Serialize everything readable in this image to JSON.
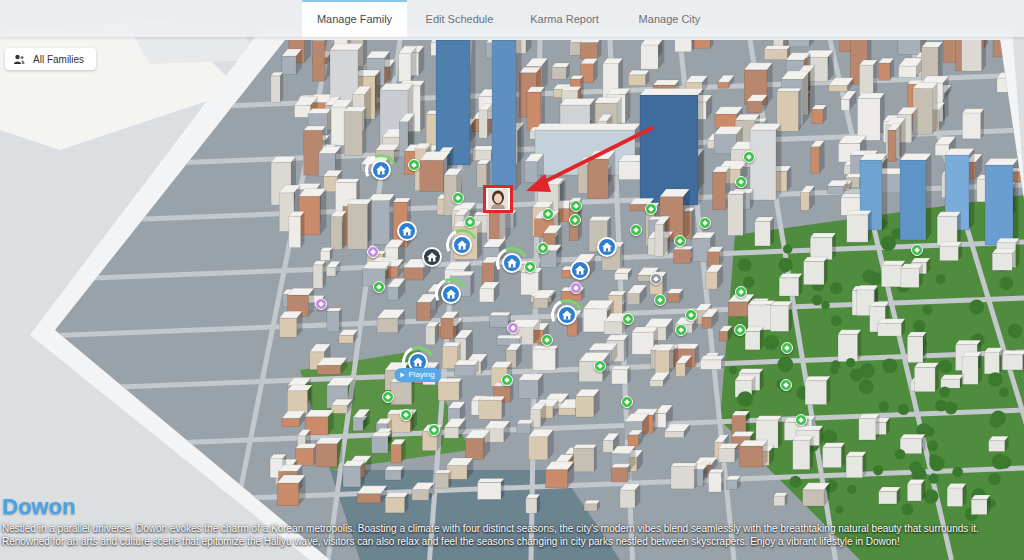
{
  "tabs": [
    {
      "label": "Manage Family",
      "selected": true
    },
    {
      "label": "Edit Schedule",
      "selected": false
    },
    {
      "label": "Karma Report",
      "selected": false
    },
    {
      "label": "Manage City",
      "selected": false
    }
  ],
  "filter": {
    "label": "All Families"
  },
  "map": {
    "pins": [
      {
        "kind": "household",
        "color": "#2f7fd1",
        "ringed": true
      },
      {
        "kind": "household",
        "color": "#2f7fd1",
        "ringed": false
      },
      {
        "kind": "household",
        "color": "#2f7fd1",
        "ringed": true
      },
      {
        "kind": "household",
        "color": "#2f7fd1",
        "ringed": true
      },
      {
        "kind": "household",
        "color": "#2f7fd1",
        "ringed": false
      },
      {
        "kind": "household",
        "color": "#2f7fd1",
        "ringed": false
      },
      {
        "kind": "household",
        "color": "#2f7fd1",
        "ringed": true
      },
      {
        "kind": "household",
        "color": "#2f7fd1",
        "ringed": true
      },
      {
        "kind": "household",
        "color": "#2f7fd1",
        "ringed": true,
        "badge": "Playing"
      },
      {
        "kind": "household",
        "color": "#33414f",
        "ringed": false
      },
      {
        "kind": "venue",
        "color": "#c58ae0"
      },
      {
        "kind": "venue",
        "color": "#c58ae0"
      },
      {
        "kind": "venue",
        "color": "#c58ae0"
      },
      {
        "kind": "venue",
        "color": "#c58ae0"
      },
      {
        "kind": "vacant",
        "color": "#8f979e"
      },
      {
        "kind": "portrait",
        "color": "#ffffff",
        "highlighted": true
      },
      {
        "kind": "lot",
        "color": "#3cc24a"
      },
      {
        "kind": "lot",
        "color": "#3cc24a"
      },
      {
        "kind": "lot",
        "color": "#3cc24a"
      },
      {
        "kind": "lot",
        "color": "#3cc24a"
      },
      {
        "kind": "lot",
        "color": "#3cc24a"
      },
      {
        "kind": "lot",
        "color": "#3cc24a"
      },
      {
        "kind": "lot",
        "color": "#3cc24a"
      },
      {
        "kind": "lot",
        "color": "#3cc24a"
      },
      {
        "kind": "lot",
        "color": "#3cc24a"
      },
      {
        "kind": "lot",
        "color": "#3cc24a"
      },
      {
        "kind": "lot",
        "color": "#3cc24a"
      },
      {
        "kind": "lot",
        "color": "#3cc24a"
      },
      {
        "kind": "lot",
        "color": "#3cc24a"
      },
      {
        "kind": "lot",
        "color": "#3cc24a"
      },
      {
        "kind": "lot",
        "color": "#3cc24a"
      },
      {
        "kind": "lot",
        "color": "#3cc24a"
      },
      {
        "kind": "lot",
        "color": "#3cc24a"
      },
      {
        "kind": "lot",
        "color": "#3cc24a"
      },
      {
        "kind": "lot",
        "color": "#3cc24a"
      },
      {
        "kind": "lot",
        "color": "#3cc24a"
      },
      {
        "kind": "lot",
        "color": "#3cc24a"
      },
      {
        "kind": "lot",
        "color": "#3cc24a"
      },
      {
        "kind": "lot",
        "color": "#3cc24a"
      },
      {
        "kind": "lot",
        "color": "#3cc24a"
      },
      {
        "kind": "lot",
        "color": "#3cc24a"
      },
      {
        "kind": "lot",
        "color": "#3cc24a"
      },
      {
        "kind": "lot",
        "color": "#3cc24a"
      },
      {
        "kind": "lot",
        "color": "#3cc24a"
      },
      {
        "kind": "lot",
        "color": "#3cc24a"
      },
      {
        "kind": "lot",
        "color": "#3cc24a"
      },
      {
        "kind": "lot",
        "color": "#3cc24a"
      },
      {
        "kind": "lot",
        "color": "#3cc24a"
      }
    ]
  },
  "city": {
    "name": "Dowon",
    "description": "Nestled in a parallel universe, Dowon evokes the charm of a Korean metropolis. Boasting a climate with four distinct seasons, the city's modern vibes blend seamlessly with the breathtaking natural beauty that surrounds it. Renowned for an arts and culture scene that epitomize the Hallyu wave, visitors can also relax and feel the seasons changing in city parks nestled between skyscrapers. Enjoy a vibrant lifestyle in Dowon!"
  }
}
